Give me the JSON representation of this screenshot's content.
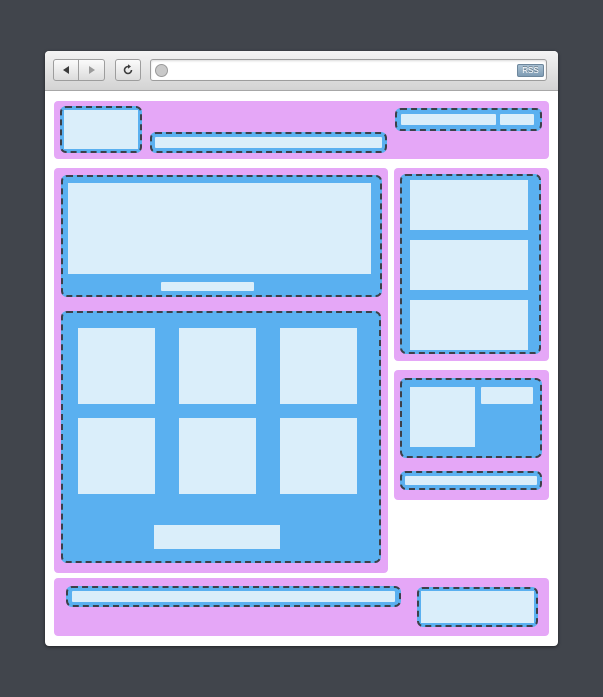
{
  "browser": {
    "back_icon": "back-arrow-icon",
    "forward_icon": "forward-arrow-icon",
    "refresh_icon": "refresh-icon",
    "address": {
      "value": "",
      "placeholder": ""
    },
    "site_icon": "globe-icon",
    "rss_label": "RSS"
  },
  "colors": {
    "desktop": "#41454c",
    "region": "#e5a7f7",
    "module": "#5ab0f0",
    "placeholder": "#daeefa",
    "dash_border": "#3c4049"
  }
}
